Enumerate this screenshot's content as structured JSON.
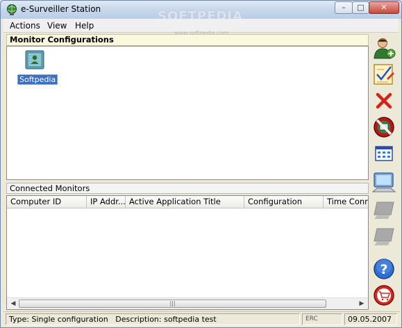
{
  "window": {
    "title": "e-Surveiller Station",
    "watermark": "SOFTPEDIA",
    "watermark_small": "www.softpedia.com",
    "controls": {
      "minimize": "–",
      "maximize": "□",
      "close": "✕"
    }
  },
  "menu": [
    {
      "label": "Actions"
    },
    {
      "label": "View"
    },
    {
      "label": "Help"
    }
  ],
  "config_panel": {
    "title": "Monitor Configurations",
    "items": [
      {
        "label": "Softpedia",
        "icon": "monitor-config-icon",
        "selected": true
      }
    ]
  },
  "monitors_panel": {
    "title": "Connected Monitors",
    "columns": [
      "Computer ID",
      "IP Addr...",
      "Active Application Title",
      "Configuration",
      "Time Conne"
    ],
    "rows": []
  },
  "toolbar": [
    {
      "name": "add-user-button",
      "icon": "add-user-icon"
    },
    {
      "name": "edit-configuration-button",
      "icon": "edit-checklist-icon"
    },
    {
      "name": "delete-button",
      "icon": "red-x-icon"
    },
    {
      "name": "stop-monitoring-button",
      "icon": "no-entry-icon"
    },
    {
      "name": "view-grid-button",
      "icon": "grid-icon"
    },
    {
      "name": "monitor-active-button",
      "icon": "computer-icon"
    },
    {
      "name": "monitor-disabled-button-1",
      "icon": "computer-disabled-icon"
    },
    {
      "name": "monitor-disabled-button-2",
      "icon": "computer-disabled-icon"
    },
    {
      "name": "help-button",
      "icon": "question-icon"
    },
    {
      "name": "shop-button",
      "icon": "shopping-cart-icon"
    }
  ],
  "status": {
    "type": "Type: Single configuration",
    "description": "Description: softpedia test",
    "indicator": "ERC",
    "date": "09.05.2007"
  },
  "scrollbar": {
    "grip": "|||"
  },
  "colors": {
    "selection": "#3a6fc6",
    "panel_header_bg": "#fbf8e0",
    "window_bg": "#ece9d8",
    "close_button": "#c8473a"
  }
}
